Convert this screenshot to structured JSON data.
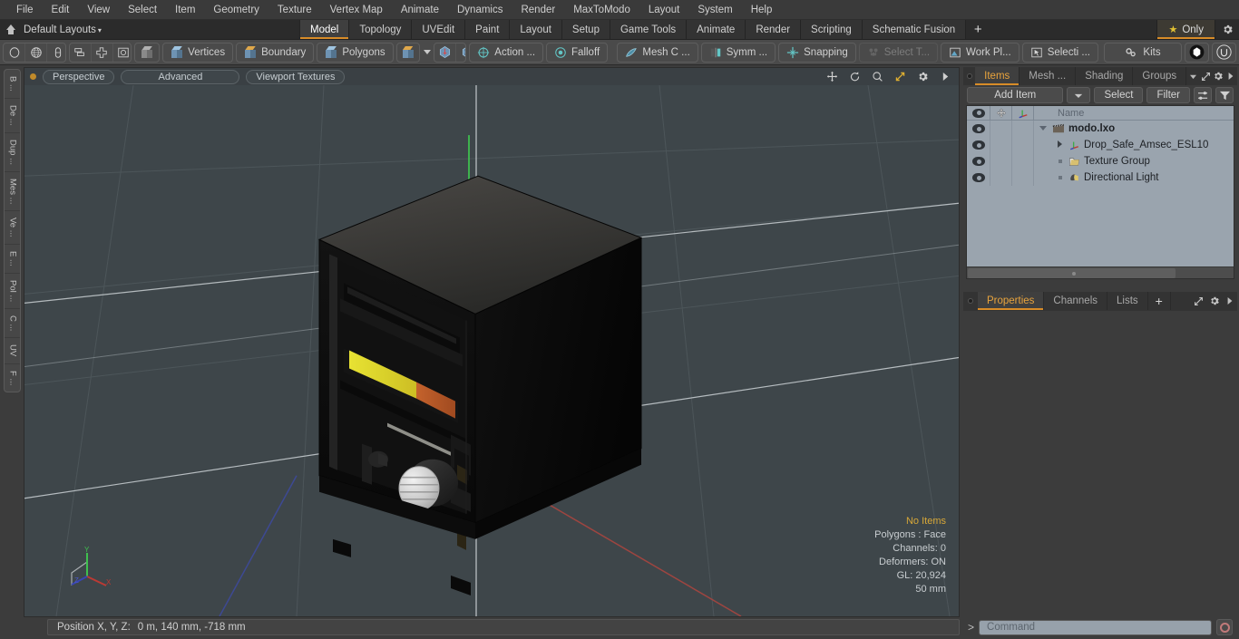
{
  "app": {
    "title": "modo",
    "accent": "#d88c28",
    "panel_bg": "#3c3c3c",
    "viewport_bg": "#3e464a",
    "tree_bg": "#9aa4ae"
  },
  "menubar": {
    "items": [
      {
        "label": "File"
      },
      {
        "label": "Edit"
      },
      {
        "label": "View"
      },
      {
        "label": "Select"
      },
      {
        "label": "Item"
      },
      {
        "label": "Geometry"
      },
      {
        "label": "Texture"
      },
      {
        "label": "Vertex Map"
      },
      {
        "label": "Animate"
      },
      {
        "label": "Dynamics"
      },
      {
        "label": "Render"
      },
      {
        "label": "MaxToModo"
      },
      {
        "label": "Layout"
      },
      {
        "label": "System"
      },
      {
        "label": "Help"
      }
    ]
  },
  "layoutbar": {
    "layout_selector": "Default Layouts",
    "caret": "▾",
    "tabs": [
      {
        "label": "Model",
        "active": true
      },
      {
        "label": "Topology",
        "active": false
      },
      {
        "label": "UVEdit",
        "active": false
      },
      {
        "label": "Paint",
        "active": false
      },
      {
        "label": "Layout",
        "active": false
      },
      {
        "label": "Setup",
        "active": false
      },
      {
        "label": "Game Tools",
        "active": false
      },
      {
        "label": "Animate",
        "active": false
      },
      {
        "label": "Render",
        "active": false
      },
      {
        "label": "Scripting",
        "active": false
      },
      {
        "label": "Schematic Fusion",
        "active": false
      }
    ],
    "add_tab": "+",
    "only_label": "Only",
    "star": "★"
  },
  "toolbar": {
    "mode_icons": [
      {
        "name": "lasso-circle-icon"
      },
      {
        "name": "globe-icon"
      },
      {
        "name": "paint-brush-icon"
      },
      {
        "name": "element-paint-icon"
      }
    ],
    "falloff_icons": [
      {
        "name": "layers-icon"
      },
      {
        "name": "center-cross-icon"
      },
      {
        "name": "bounding-box-icon"
      },
      {
        "name": "circle-icon"
      }
    ],
    "item_mode_label": "",
    "selection_modes": [
      {
        "label": "Vertices",
        "icon": "cube-vertices-icon"
      },
      {
        "label": "Boundary",
        "icon": "cube-boundary-icon"
      },
      {
        "label": "Polygons",
        "icon": "cube-polygons-icon"
      }
    ],
    "tools": [
      {
        "label": "Action    ...",
        "icon": "action-center-icon",
        "dim": false
      },
      {
        "label": "Falloff",
        "icon": "falloff-icon",
        "dim": false
      },
      {
        "label": "Mesh C ...",
        "icon": "mesh-constraint-icon",
        "dim": false
      },
      {
        "label": "Symm ...",
        "icon": "symmetry-icon",
        "dim": false
      },
      {
        "label": "Snapping",
        "icon": "snapping-icon",
        "dim": false
      },
      {
        "label": "Select T...",
        "icon": "select-through-icon",
        "dim": true
      },
      {
        "label": "Work Pl...",
        "icon": "work-plane-icon",
        "dim": false
      },
      {
        "label": "Selecti ...",
        "icon": "selection-set-icon",
        "dim": false
      }
    ],
    "kits_label": "Kits",
    "right_icons": [
      {
        "name": "modo-logo-icon"
      },
      {
        "name": "unreal-engine-icon"
      }
    ]
  },
  "left_rail": {
    "tabs": [
      {
        "label": "B ..."
      },
      {
        "label": "De ..."
      },
      {
        "label": "Dup ..."
      },
      {
        "label": "Mes ..."
      },
      {
        "label": "Ve ..."
      },
      {
        "label": "E ..."
      },
      {
        "label": "Pol ..."
      },
      {
        "label": "C ..."
      },
      {
        "label": "UV"
      },
      {
        "label": "F ..."
      }
    ]
  },
  "viewport": {
    "header": {
      "view_mode": "Perspective",
      "shading": "Advanced",
      "textures": "Viewport Textures",
      "icons": [
        {
          "name": "pan-icon"
        },
        {
          "name": "rotate-icon"
        },
        {
          "name": "zoom-icon"
        },
        {
          "name": "maximize-icon"
        },
        {
          "name": "viewport-settings-gear-icon"
        },
        {
          "name": "viewport-more-arrow-icon"
        }
      ]
    },
    "hud": {
      "no_items": "No Items",
      "polygons": "Polygons : Face",
      "channels": "Channels: 0",
      "deformers": "Deformers: ON",
      "gl": "GL: 20,924",
      "grid_size": "50 mm"
    },
    "axis_gizmo": {
      "x": "X",
      "y": "Y",
      "z": "Z",
      "x_color": "#b03a3a",
      "y_color": "#3aab3a",
      "z_color": "#3a47b0"
    },
    "model": "Drop safe 3D model (black safe with yellow and orange decal stripe, round chrome dial, door handle)"
  },
  "statusbar": {
    "position_label": "Position X, Y, Z:",
    "position_value": "0 m, 140 mm, -718 mm"
  },
  "right_panel": {
    "top_tabs": [
      {
        "label": "Items",
        "active": true
      },
      {
        "label": "Mesh ...",
        "active": false
      },
      {
        "label": "Shading",
        "active": false
      },
      {
        "label": "Groups",
        "active": false
      }
    ],
    "top_tab_icons": [
      {
        "name": "tab-dropdown-caret-icon"
      },
      {
        "name": "panel-expand-icon"
      },
      {
        "name": "panel-gear-icon"
      },
      {
        "name": "panel-more-arrow-icon"
      }
    ],
    "controls": {
      "add_item": "Add Item",
      "add_item_arrow": "▾",
      "select": "Select",
      "filter": "Filter",
      "list_icon": "list-options-icon",
      "funnel_icon": "filter-funnel-icon"
    },
    "tree": {
      "columns": [
        {
          "name": "visibility-column",
          "icon": "eye-icon"
        },
        {
          "name": "lock-column",
          "icon": "move-cross-icon"
        },
        {
          "name": "axis-column",
          "icon": "axis-icon"
        },
        {
          "name": "name-column",
          "label": "Name"
        }
      ],
      "rows": [
        {
          "name": "modo.lxo",
          "icon": "scene-clapper-icon",
          "depth": 0,
          "twisty": "down",
          "root": true
        },
        {
          "name": "Drop_Safe_Amsec_ESL10",
          "icon": "mesh-axis-icon",
          "depth": 1,
          "twisty": "right",
          "root": false
        },
        {
          "name": "Texture Group",
          "icon": "folder-icon",
          "depth": 1,
          "twisty": "dot",
          "root": false
        },
        {
          "name": "Directional Light",
          "icon": "light-icon",
          "depth": 1,
          "twisty": "dot",
          "root": false
        }
      ]
    },
    "bottom_tabs": [
      {
        "label": "Properties",
        "active": true
      },
      {
        "label": "Channels",
        "active": false
      },
      {
        "label": "Lists",
        "active": false
      },
      {
        "label": "+",
        "active": false
      }
    ]
  },
  "command_bar": {
    "prompt": ">",
    "placeholder": "Command",
    "record_icon": "record-circle-icon"
  }
}
